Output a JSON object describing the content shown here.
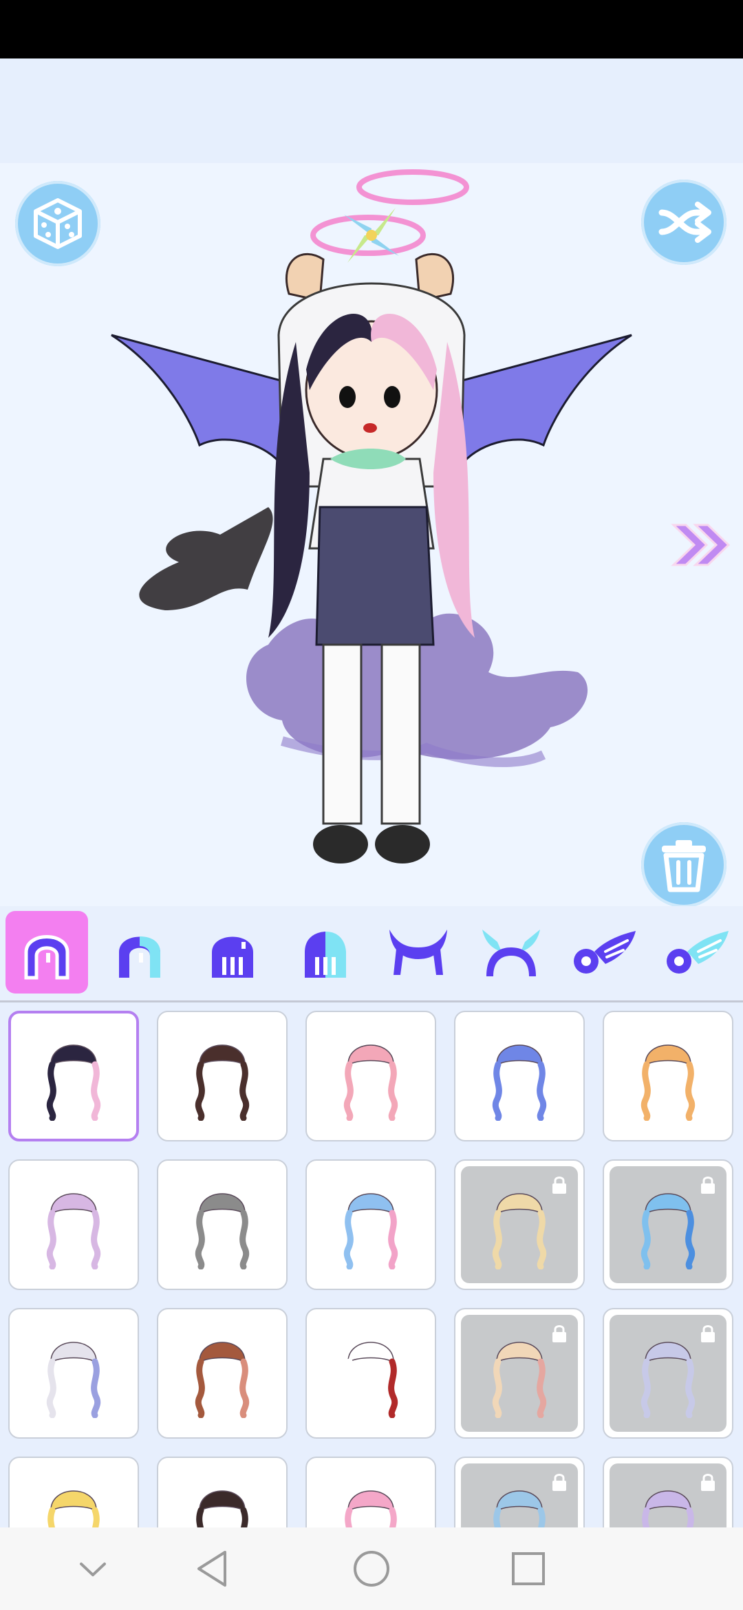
{
  "colors": {
    "accent_pink": "#f37ff0",
    "accent_purple": "#5b3ff0",
    "accent_cyan": "#7fe3f4",
    "button_blue": "#8fcef5",
    "selected_border": "#b47ff0",
    "locked_gray": "#c7c9cb"
  },
  "stage": {
    "icons": [
      "dice-icon",
      "shuffle-icon",
      "next-arrows-icon",
      "trash-icon"
    ]
  },
  "tabs": [
    {
      "name": "hair-front",
      "color": "#5b3ff0",
      "active": true
    },
    {
      "name": "hair-front-alt",
      "color": "#5b3ff0",
      "active": false
    },
    {
      "name": "hair-back",
      "color": "#5b3ff0",
      "active": false
    },
    {
      "name": "hair-back-alt",
      "color": "#5b3ff0",
      "active": false
    },
    {
      "name": "horns",
      "color": "#5b3ff0",
      "active": false
    },
    {
      "name": "horns-alt",
      "color": "#7fe3f4",
      "active": false
    },
    {
      "name": "wings",
      "color": "#5b3ff0",
      "active": false
    },
    {
      "name": "wings-alt",
      "color": "#7fe3f4",
      "active": false
    }
  ],
  "hair_items": [
    {
      "color": "#2b2540",
      "accent": "#f1b7d8",
      "locked": false,
      "selected": true
    },
    {
      "color": "#4a2f2c",
      "accent": "#4a2f2c",
      "locked": false,
      "selected": false
    },
    {
      "color": "#f3a7b8",
      "accent": "#f3a7b8",
      "locked": false,
      "selected": false
    },
    {
      "color": "#6f86e6",
      "accent": "#6f86e6",
      "locked": false,
      "selected": false
    },
    {
      "color": "#f2b169",
      "accent": "#f2b169",
      "locked": false,
      "selected": false
    },
    {
      "color": "#d7b7e3",
      "accent": "#d7b7e3",
      "locked": false,
      "selected": false
    },
    {
      "color": "#8b8b8b",
      "accent": "#8b8b8b",
      "locked": false,
      "selected": false
    },
    {
      "color": "#8fc0f0",
      "accent": "#f2a3c8",
      "locked": false,
      "selected": false
    },
    {
      "color": "#efd9a8",
      "accent": "#efd9a8",
      "locked": true,
      "selected": false
    },
    {
      "color": "#7fc0ee",
      "accent": "#4c8fe0",
      "locked": true,
      "selected": false
    },
    {
      "color": "#e5e3ec",
      "accent": "#9aa0e0",
      "locked": false,
      "selected": false
    },
    {
      "color": "#a4593d",
      "accent": "#d98e7c",
      "locked": false,
      "selected": false
    },
    {
      "color": "#ffffff",
      "accent": "#b12a2a",
      "locked": false,
      "selected": false
    },
    {
      "color": "#f1d7b8",
      "accent": "#e5a7a0",
      "locked": true,
      "selected": false
    },
    {
      "color": "#c7c9e8",
      "accent": "#c7c9e8",
      "locked": true,
      "selected": false
    },
    {
      "color": "#f5d66a",
      "accent": "#f5d66a",
      "locked": false,
      "selected": false
    },
    {
      "color": "#3b2a2a",
      "accent": "#3b2a2a",
      "locked": false,
      "selected": false
    },
    {
      "color": "#f4a7c8",
      "accent": "#f4a7c8",
      "locked": false,
      "selected": false
    },
    {
      "color": "#9cc7e8",
      "accent": "#9cc7e8",
      "locked": true,
      "selected": false
    },
    {
      "color": "#c9b7e8",
      "accent": "#c9b7e8",
      "locked": true,
      "selected": false
    }
  ],
  "nav": {
    "icons": [
      "chevron-down-icon",
      "back-triangle-icon",
      "home-circle-icon",
      "recents-square-icon"
    ]
  }
}
